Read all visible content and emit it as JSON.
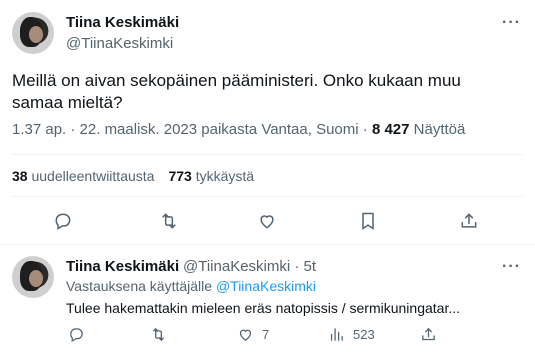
{
  "main_tweet": {
    "display_name": "Tiina Keskimäki",
    "handle": "@TiinaKeskimki",
    "text": "Meillä on aivan sekopäinen pääministeri. Onko kukaan muu samaa mieltä?",
    "meta_prefix": "1.37 ap. · 22. maalisk. 2023 paikasta Vantaa, Suomi · ",
    "views_count": "8 427",
    "views_label": "Näyttöä",
    "retweets_count": "38",
    "retweets_label": "uudelleentwiittausta",
    "likes_count": "773",
    "likes_label": "tykkäystä",
    "more_label": "···"
  },
  "reply_tweet": {
    "display_name": "Tiina Keskimäki",
    "handle_time": "@TiinaKeskimki · 5t",
    "replying_prefix": "Vastauksena käyttäjälle",
    "replying_handle": "@TiinaKeskimki",
    "text": "Tulee hakemattakin mieleen eräs natopissis / sermikuningatar...",
    "likes": "7",
    "views": "523",
    "more_label": "···"
  },
  "icons": [
    "reply-icon",
    "retweet-icon",
    "like-icon",
    "bookmark-icon",
    "share-icon",
    "views-icon"
  ]
}
